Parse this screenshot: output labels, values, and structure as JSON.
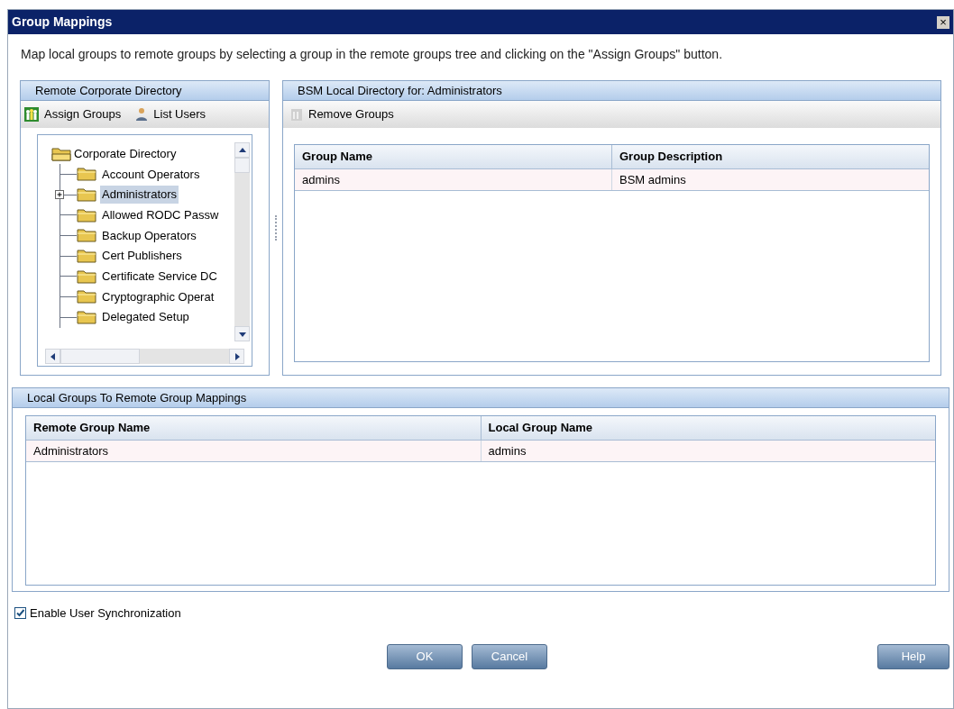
{
  "window": {
    "title": "Group Mappings",
    "close": "×"
  },
  "instruction": "Map local groups to remote groups by selecting a group in the remote groups tree and clicking on the \"Assign Groups\" button.",
  "remote_panel": {
    "title": "Remote Corporate Directory",
    "toolbar": [
      {
        "label": "Assign Groups",
        "kind": "assign",
        "disabled": false
      },
      {
        "label": "List Users",
        "kind": "users",
        "disabled": false
      }
    ],
    "tree": {
      "label": "Corporate Directory",
      "expanded": true,
      "children": [
        {
          "label": "Account Operators",
          "selected": false,
          "has_children": false
        },
        {
          "label": "Administrators",
          "selected": true,
          "has_children": true
        },
        {
          "label": "Allowed RODC Passw",
          "selected": false,
          "has_children": false
        },
        {
          "label": "Backup Operators",
          "selected": false,
          "has_children": false
        },
        {
          "label": "Cert Publishers",
          "selected": false,
          "has_children": false
        },
        {
          "label": "Certificate Service DC",
          "selected": false,
          "has_children": false
        },
        {
          "label": "Cryptographic Operat",
          "selected": false,
          "has_children": false
        },
        {
          "label": "Delegated Setup",
          "selected": false,
          "has_children": false
        }
      ]
    }
  },
  "local_panel": {
    "title": "BSM Local Directory for: Administrators",
    "toolbar": [
      {
        "label": "Remove Groups",
        "kind": "remove",
        "disabled": false
      }
    ],
    "table": {
      "columns": [
        "Group Name",
        "Group Description"
      ],
      "rows": [
        [
          "admins",
          "BSM admins"
        ]
      ]
    }
  },
  "mappings_panel": {
    "title": "Local Groups To Remote Group Mappings",
    "table": {
      "columns": [
        "Remote Group Name",
        "Local Group Name"
      ],
      "rows": [
        [
          "Administrators",
          "admins"
        ]
      ]
    }
  },
  "sync": {
    "label": "Enable User Synchronization",
    "checked": true
  },
  "buttons": [
    {
      "label": "OK",
      "kind": "ok"
    },
    {
      "label": "Cancel",
      "kind": "cancel"
    },
    {
      "label": "Help",
      "kind": "help"
    }
  ]
}
